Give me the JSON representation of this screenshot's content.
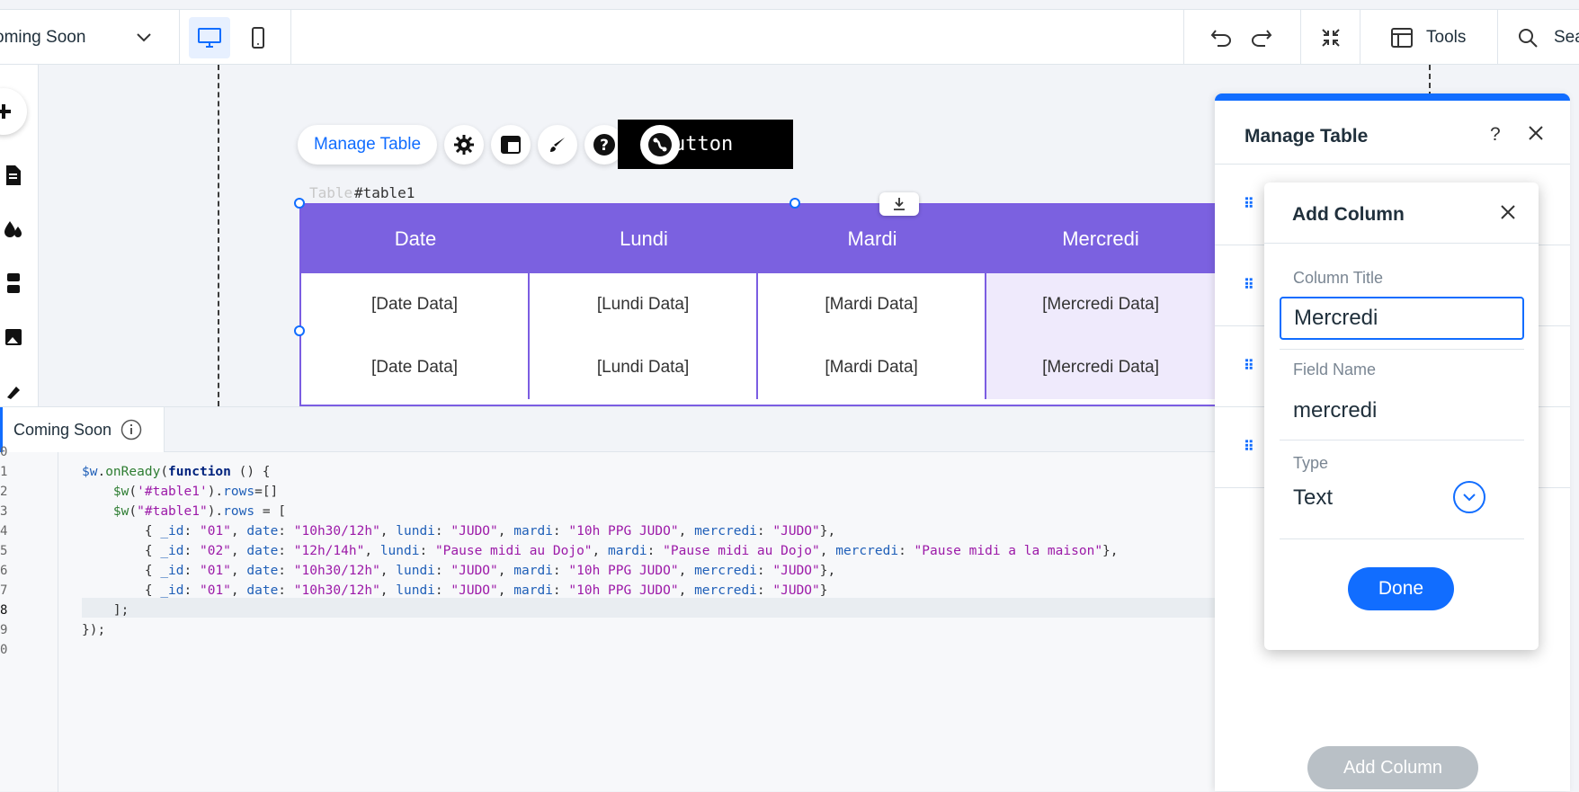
{
  "topbar": {
    "page_name": "oming Soon",
    "tools_label": "Tools",
    "search_label": "Sea"
  },
  "toolbar": {
    "manage_table_label": "Manage Table",
    "button_text": "utton"
  },
  "table": {
    "id_label": "#table1",
    "id_prefix_faint": "Table",
    "headers": [
      "Date",
      "Lundi",
      "Mardi",
      "Mercredi"
    ],
    "rows": [
      [
        "[Date Data]",
        "[Lundi Data]",
        "[Mardi Data]",
        "[Mercredi Data]"
      ],
      [
        "[Date Data]",
        "[Lundi Data]",
        "[Mardi Data]",
        "[Mercredi Data]"
      ]
    ]
  },
  "code": {
    "tab_label": "Coming Soon",
    "line_numbers": [
      "0",
      "1",
      "2",
      "3",
      "4",
      "5",
      "6",
      "7",
      "8",
      "9",
      "0"
    ]
  },
  "manage_panel": {
    "title": "Manage Table",
    "help": "?",
    "add_column_label": "Add Column"
  },
  "add_column_dialog": {
    "title": "Add Column",
    "column_title_label": "Column Title",
    "column_title_value": "Mercredi",
    "field_name_label": "Field Name",
    "field_name_value": "mercredi",
    "type_label": "Type",
    "type_value": "Text",
    "done_label": "Done"
  }
}
